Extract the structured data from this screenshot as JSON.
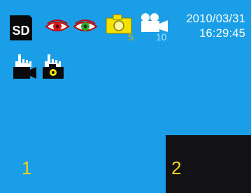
{
  "status_bar": {
    "storage_label": "SD",
    "photo_count": "5",
    "video_count": "10",
    "date": "2010/03/31",
    "time": "16:29:45"
  },
  "icons": {
    "storage": "sd-card-icon",
    "red_eye": "red-eye-icon",
    "green_eye": "green-eye-icon",
    "photo": "camera-icon",
    "video": "video-camera-icon",
    "hand_video": "hand-video-mode-icon",
    "hand_photo": "hand-photo-mode-icon"
  },
  "zones": {
    "zone_1": "1",
    "zone_2": "2"
  },
  "colors": {
    "background": "#1a9ee8",
    "accent_yellow": "#f2d21a",
    "panel_black": "#121214"
  }
}
